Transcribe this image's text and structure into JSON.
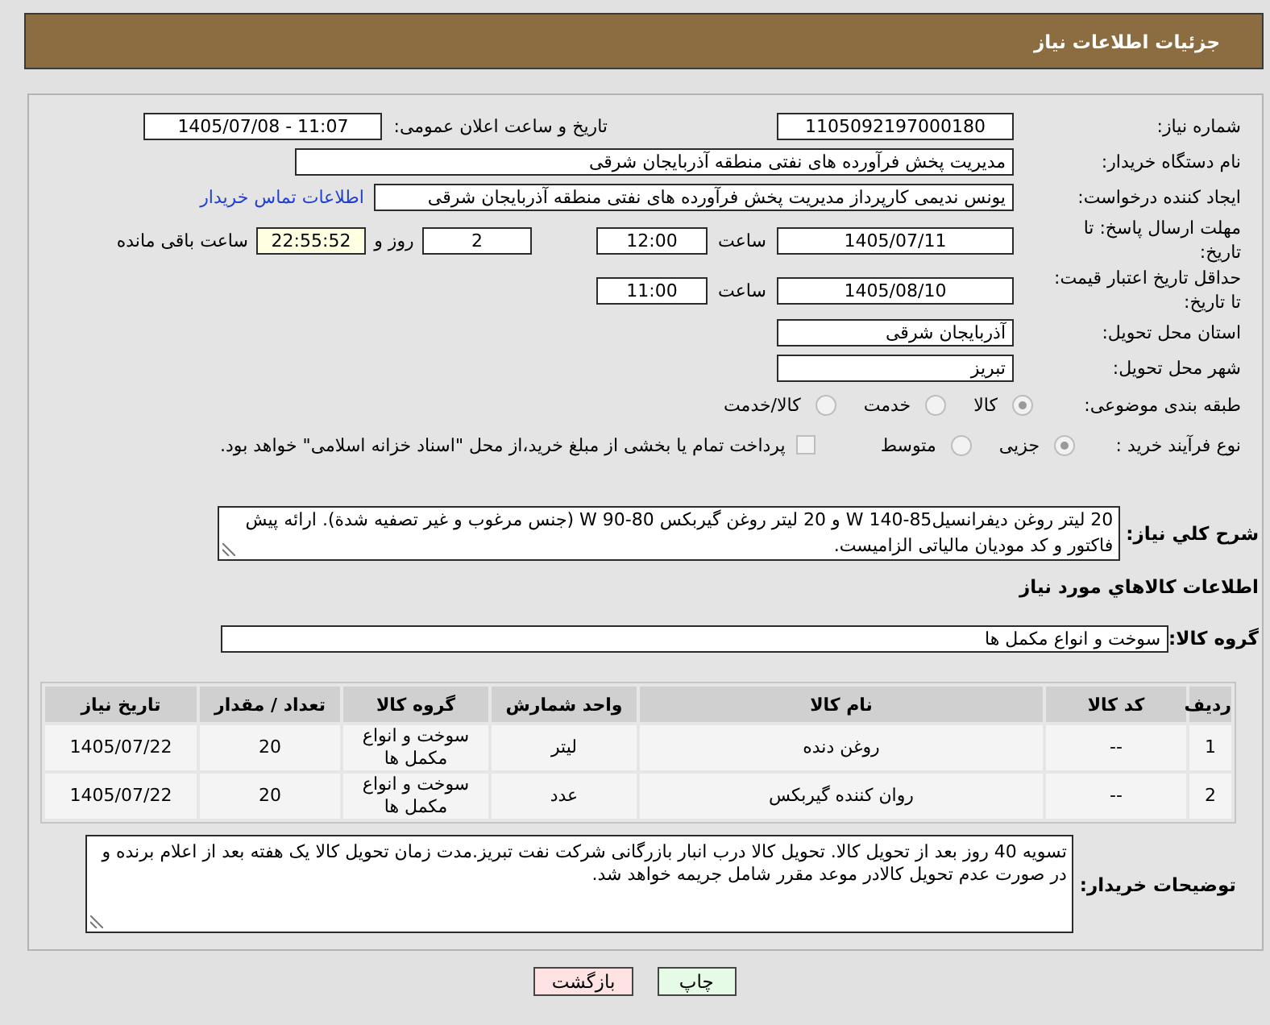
{
  "header": {
    "title": "جزئیات اطلاعات نیاز"
  },
  "need_number": {
    "label": "شماره نیاز:",
    "value": "1105092197000180"
  },
  "announce_datetime": {
    "label": "تاریخ و ساعت اعلان عمومی:",
    "value": "1405/07/08 - 11:07"
  },
  "buyer_org": {
    "label": "نام دستگاه خریدار:",
    "value": "مدیریت پخش فرآورده های نفتی منطقه آذربایجان شرقی"
  },
  "requester": {
    "label": "ایجاد کننده درخواست:",
    "value": "یونس ندیمی کارپرداز مدیریت پخش فرآورده های نفتی منطقه آذربایجان شرقی",
    "link": "اطلاعات تماس خریدار"
  },
  "response_deadline": {
    "label": "مهلت ارسال پاسخ: تا تاریخ:",
    "date": "1405/07/11",
    "time_label": "ساعت",
    "time": "12:00",
    "days": "2",
    "days_label": "روز و",
    "remaining": "22:55:52",
    "remaining_label": "ساعت باقی مانده"
  },
  "price_validity": {
    "label": "حداقل تاریخ اعتبار قیمت: تا تاریخ:",
    "date": "1405/08/10",
    "time_label": "ساعت",
    "time": "11:00"
  },
  "delivery_province": {
    "label": "استان محل تحویل:",
    "value": "آذربایجان شرقی"
  },
  "delivery_city": {
    "label": "شهر محل تحویل:",
    "value": "تبریز"
  },
  "category": {
    "label": "طبقه بندی موضوعی:",
    "options": [
      {
        "label": "کالا",
        "selected": true
      },
      {
        "label": "خدمت",
        "selected": false
      },
      {
        "label": "کالا/خدمت",
        "selected": false
      }
    ]
  },
  "purchase_process": {
    "label": "نوع فرآیند خرید :",
    "options": [
      {
        "label": "جزیی",
        "selected": true
      },
      {
        "label": "متوسط",
        "selected": false
      }
    ],
    "treasury_payment": {
      "label": "پرداخت تمام یا بخشی از مبلغ خرید،از محل \"اسناد خزانه اسلامی\" خواهد بود.",
      "checked": false
    }
  },
  "description": {
    "label": "شرح کلي نياز:",
    "value": "20 لیتر روغن دیفرانسیل85-140 W و 20 لیتر روغن گیربکس 80-90 W (جنس مرغوب و غیر تصفیه شدة). ارائه پیش فاکتور و کد مودیان مالیاتی الزامیست."
  },
  "goods_section": {
    "title": "اطلاعات كالاهاي مورد نياز",
    "group_label": "گروه کالا:",
    "group_value": "سوخت و انواع مکمل ها"
  },
  "table": {
    "columns": [
      "ردیف",
      "کد کالا",
      "نام کالا",
      "واحد شمارش",
      "گروه کالا",
      "تعداد / مقدار",
      "تاریخ نیاز"
    ],
    "rows": [
      [
        "1",
        "--",
        "روغن دنده",
        "لیتر",
        "سوخت و انواع مکمل ها",
        "20",
        "1405/07/22"
      ],
      [
        "2",
        "--",
        "روان کننده گیربکس",
        "عدد",
        "سوخت و انواع مکمل ها",
        "20",
        "1405/07/22"
      ]
    ]
  },
  "buyer_notes": {
    "label": "توضیحات خریدار:",
    "value": "تسویه 40 روز بعد از تحویل کالا. تحویل کالا درب انبار بازرگانی شرکت نفت تبریز.مدت زمان تحویل کالا یک هفته بعد از اعلام برنده و در صورت عدم تحویل کالادر موعد مقرر شامل جریمه خواهد شد."
  },
  "buttons": [
    {
      "label": "چاپ",
      "kind": "print"
    },
    {
      "label": "بازگشت",
      "kind": "back"
    }
  ]
}
